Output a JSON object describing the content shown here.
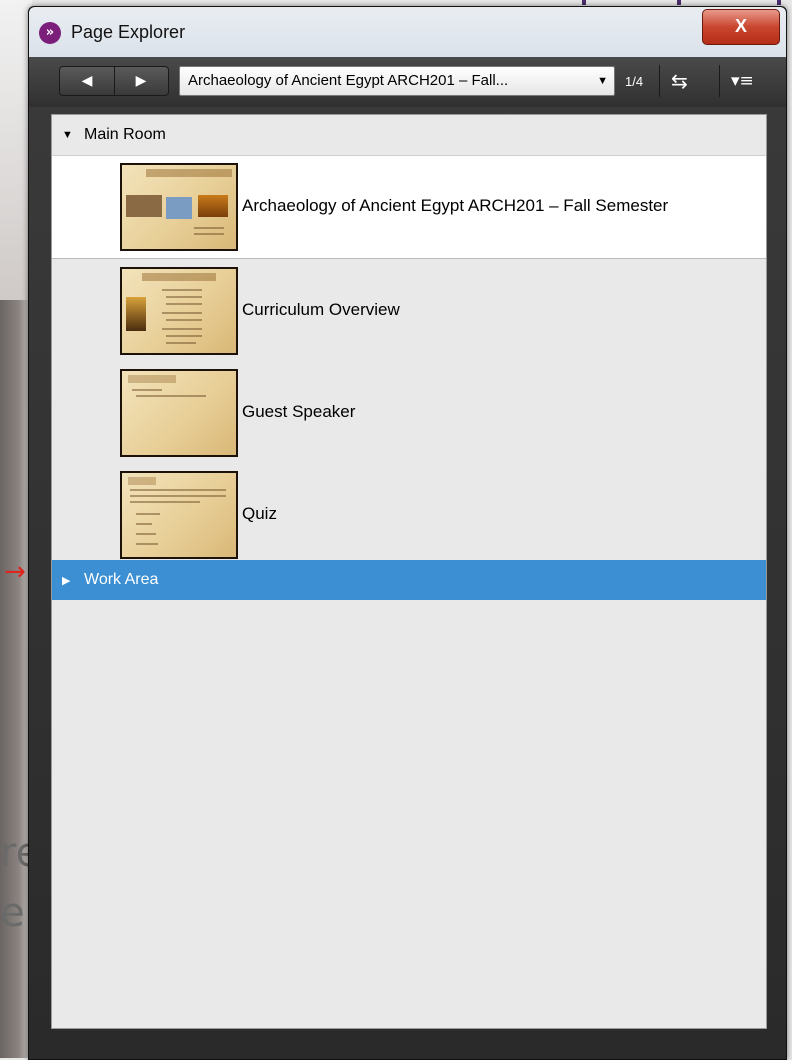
{
  "window": {
    "title": "Page Explorer",
    "close_label": "X"
  },
  "toolbar": {
    "prev_icon": "◀",
    "next_icon": "▶",
    "selected_page": "Archaeology of Ancient Egypt ARCH201 – Fall...",
    "page_count": "1/4"
  },
  "tree": {
    "main_room": {
      "label": "Main Room",
      "expanded": true
    },
    "pages": [
      {
        "label": "Archaeology of Ancient Egypt ARCH201 – Fall Semester",
        "selected": true
      },
      {
        "label": "Curriculum Overview",
        "selected": false
      },
      {
        "label": "Guest Speaker",
        "selected": false
      },
      {
        "label": "Quiz",
        "selected": false
      }
    ],
    "work_area": {
      "label": "Work Area",
      "expanded": false,
      "highlighted": true
    }
  },
  "background": {
    "text_line1": "re",
    "text_line2": "er",
    "arrow": "→"
  },
  "colors": {
    "selection": "#3b8fd2",
    "close": "#c9462f",
    "app_icon": "#7b1f7b"
  }
}
